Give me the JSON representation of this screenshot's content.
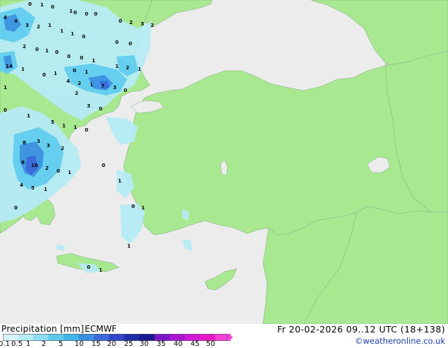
{
  "footer": {
    "title": "Precipitation [mm]",
    "model": "ECMWF",
    "datetime": "Fr 20-02-2026 09..12 UTC (18+138)",
    "credit": "©weatheronline.co.uk"
  },
  "legend": {
    "ticks": [
      "0.1",
      "0.5",
      "1",
      "2",
      "5",
      "10",
      "15",
      "20",
      "25",
      "30",
      "35",
      "40",
      "45",
      "50"
    ],
    "colors": [
      "#d8f4f8",
      "#b6ecf6",
      "#8fddf2",
      "#5ecbee",
      "#3fb5e8",
      "#3c8fe0",
      "#3a6ad8",
      "#2f47c8",
      "#1f2fa8",
      "#1a1a90",
      "#7a18c8",
      "#a818d0",
      "#d018d8",
      "#e818c8",
      "#f040d8"
    ]
  },
  "map": {
    "land_color": "#a8e890",
    "sea_color": "#ececec",
    "border_color": "#8ab08a",
    "precip_values": [
      "0",
      "1",
      "0",
      "1",
      "4",
      "4",
      "3",
      "2",
      "1",
      "0",
      "0",
      "0",
      "0",
      "2",
      "3",
      "2",
      "1",
      "1",
      "0",
      "0",
      "0",
      "2",
      "0",
      "1",
      "0",
      "0",
      "0",
      "1",
      "1",
      "2",
      "1",
      "14",
      "1",
      "0",
      "1",
      "0",
      "1",
      "4",
      "2",
      "1",
      "7",
      "3",
      "1",
      "2",
      "3",
      "0",
      "0",
      "0",
      "1",
      "5",
      "1",
      "1",
      "0",
      "8",
      "3",
      "3",
      "2",
      "6",
      "10",
      "2",
      "0",
      "1",
      "4",
      "5",
      "1",
      "0",
      "0",
      "1",
      "1",
      "1",
      "0",
      "1",
      "0"
    ],
    "city_labels": []
  }
}
